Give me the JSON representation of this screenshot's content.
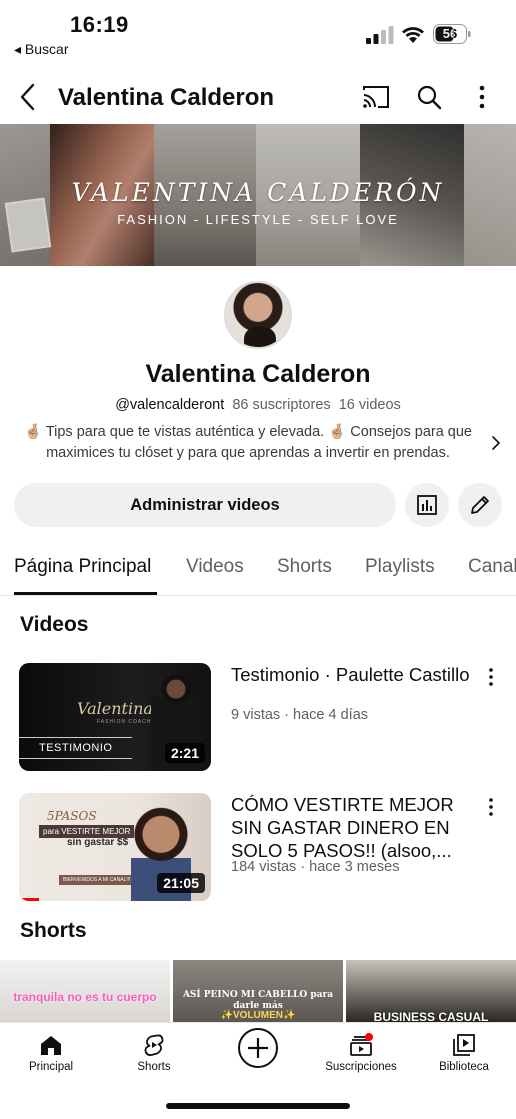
{
  "status_bar": {
    "time": "16:19",
    "back_app": "◂ Buscar",
    "battery": "56"
  },
  "header": {
    "title": "Valentina Calderon"
  },
  "banner": {
    "title": "VALENTINA CALDERÓN",
    "subtitle": "FASHION - LIFESTYLE - SELF LOVE"
  },
  "channel": {
    "name": "Valentina Calderon",
    "handle": "@valencalderont",
    "subscribers": "86 suscriptores",
    "videos_count": "16 videos",
    "description": "🤞🏼 Tips para que te vistas auténtica y elevada. 🤞🏼 Consejos para que maximices tu clóset y para que aprendas a invertir en prendas."
  },
  "actions": {
    "manage_label": "Administrar videos"
  },
  "tabs": [
    {
      "label": "Página Principal"
    },
    {
      "label": "Videos"
    },
    {
      "label": "Shorts"
    },
    {
      "label": "Playlists"
    },
    {
      "label": "Canal"
    }
  ],
  "sections": {
    "videos": "Videos",
    "shorts": "Shorts"
  },
  "videos": [
    {
      "title": "Testimonio · Paulette Castillo",
      "meta": "9 vistas · hace 4 días",
      "duration": "2:21",
      "thumb_brand": "Valentina",
      "thumb_sub": "FASHION COACH",
      "thumb_tag": "TESTIMONIO"
    },
    {
      "title": "CÓMO VESTIRTE MEJOR SIN GASTAR DINERO EN SOLO 5 PASOS!! (alsoo,...",
      "meta": "184 vistas · hace 3 meses",
      "duration": "21:05",
      "thumb_t1": "5PASOS",
      "thumb_t2": "para VESTIRTE MEJOR",
      "thumb_t3": "sin gastar $$",
      "thumb_t4": "BIENVENIDOS A MI CANAL!!!!!!"
    }
  ],
  "shorts": [
    {
      "caption": "tranquila no es tu cuerpo"
    },
    {
      "caption": "ASÍ PEINO MI CABELLO para darle más",
      "caption2": "✨VOLUMEN✨"
    },
    {
      "caption": "BUSINESS CASUAL"
    }
  ],
  "bottom_nav": [
    {
      "label": "Principal",
      "icon": "home-icon"
    },
    {
      "label": "Shorts",
      "icon": "shorts-icon"
    },
    {
      "label": "",
      "icon": "create-icon"
    },
    {
      "label": "Suscripciones",
      "icon": "subscriptions-icon"
    },
    {
      "label": "Biblioteca",
      "icon": "library-icon"
    }
  ],
  "colors": {
    "text": "#0f0f0f",
    "secondary": "#606060",
    "chip_bg": "#f0f0f0",
    "notification": "#ff0000"
  }
}
